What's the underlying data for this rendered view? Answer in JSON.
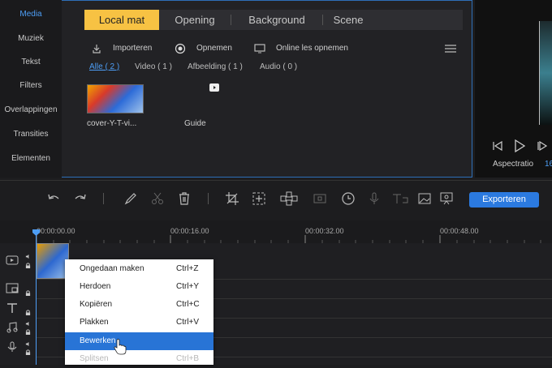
{
  "nav": {
    "items": [
      "Media",
      "Muziek",
      "Tekst",
      "Filters",
      "Overlappingen",
      "Transities",
      "Elementen"
    ]
  },
  "tabs": [
    "Local mat",
    "Opening",
    "Background",
    "Scene"
  ],
  "actions": {
    "import": "Importeren",
    "record": "Opnemen",
    "online_record": "Online les opnemen"
  },
  "filters": [
    "Alle ( 2 )",
    "Video ( 1 )",
    "Afbeelding ( 1 )",
    "Audio ( 0 )"
  ],
  "media_items": [
    {
      "name": "cover-Y-T-vi..."
    },
    {
      "name": "Guide"
    }
  ],
  "preview": {
    "aspect_label": "Aspectratio",
    "aspect_value": "16"
  },
  "toolbar": {
    "export_label": "Exporteren"
  },
  "timeline": {
    "ticks": [
      "00:00:00.00",
      "00:00:16.00",
      "00:00:32.00",
      "00:00:48.00"
    ]
  },
  "context_menu": {
    "items": [
      {
        "label": "Ongedaan maken",
        "shortcut": "Ctrl+Z",
        "state": "normal"
      },
      {
        "label": "Herdoen",
        "shortcut": "Ctrl+Y",
        "state": "normal"
      },
      {
        "label": "Kopiëren",
        "shortcut": "Ctrl+C",
        "state": "normal"
      },
      {
        "label": "Plakken",
        "shortcut": "Ctrl+V",
        "state": "normal"
      },
      {
        "label": "Bewerken",
        "shortcut": "",
        "state": "highlighted"
      },
      {
        "label": "Splitsen",
        "shortcut": "Ctrl+B",
        "state": "disabled"
      }
    ]
  },
  "colors": {
    "accent": "#4d9ef6",
    "tab_active": "#f7c243",
    "export": "#2b7ae0",
    "menu_highlight": "#2874d6"
  }
}
